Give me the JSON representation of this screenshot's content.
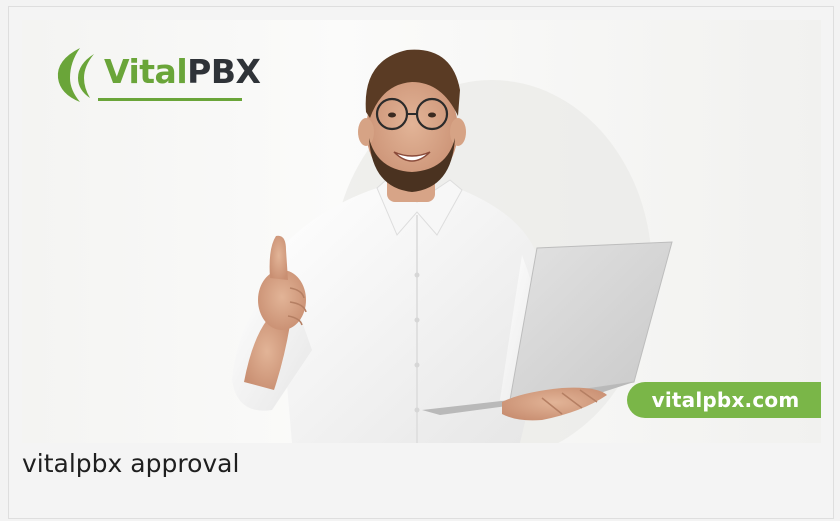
{
  "image": {
    "logo": {
      "word_vital": "Vital",
      "word_pbx": "PBX"
    },
    "url_badge": "vitalpbx.com",
    "alt": "vitalpbx approval"
  },
  "caption": "vitalpbx approval",
  "colors": {
    "brand_green": "#6aa539",
    "badge_green": "#7ab648",
    "brand_dark": "#2f3338"
  }
}
